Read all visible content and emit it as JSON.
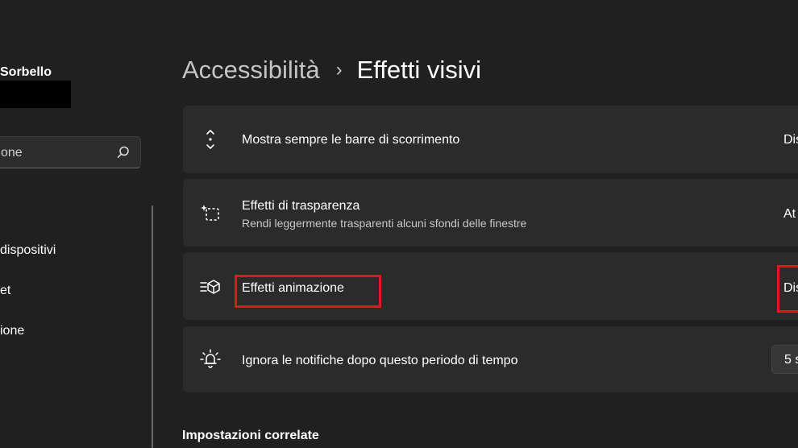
{
  "sidebar": {
    "user_name": "Sorbello",
    "search_value": "one",
    "items": [
      {
        "label": "dispositivi"
      },
      {
        "label": "et"
      },
      {
        "label": "ione"
      }
    ]
  },
  "breadcrumb": {
    "parent": "Accessibilità",
    "separator": "›",
    "current": "Effetti visivi"
  },
  "settings": [
    {
      "title": "Mostra sempre le barre di scorrimento",
      "value": "Dis"
    },
    {
      "title": "Effetti di trasparenza",
      "subtitle": "Rendi leggermente trasparenti alcuni sfondi delle finestre",
      "value": "At"
    },
    {
      "title": "Effetti animazione",
      "value": "Dis"
    },
    {
      "title": "Ignora le notifiche dopo questo periodo di tempo",
      "value": "5 s"
    }
  ],
  "related": {
    "title": "Impostazioni correlate"
  },
  "colors": {
    "background": "#202020",
    "card": "#2b2b2b",
    "highlight": "#e8141e"
  }
}
